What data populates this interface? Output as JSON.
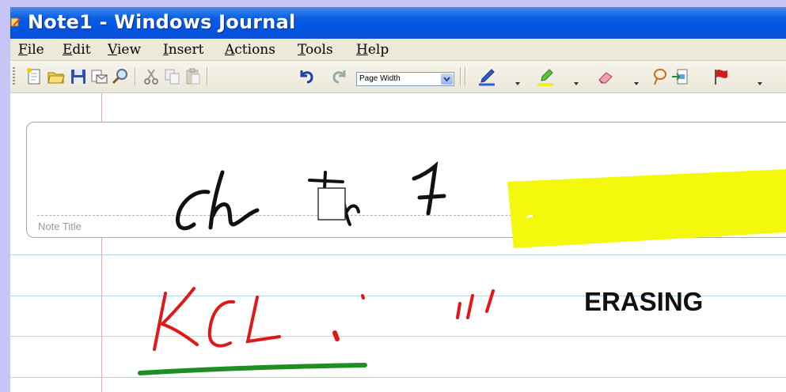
{
  "window": {
    "title": "Note1 - Windows Journal"
  },
  "menu": [
    {
      "label": "File"
    },
    {
      "label": "Edit"
    },
    {
      "label": "View"
    },
    {
      "label": "Insert"
    },
    {
      "label": "Actions"
    },
    {
      "label": "Tools"
    },
    {
      "label": "Help"
    }
  ],
  "toolbar": {
    "zoom_value": "Page Width",
    "icons": [
      "new-note-icon",
      "open-folder-icon",
      "save-disk-icon",
      "send-email-icon",
      "find-magnifier-icon",
      "cut-scissors-icon",
      "copy-icon",
      "paste-icon",
      "undo-icon",
      "redo-icon",
      "pen-icon",
      "highlighter-icon",
      "eraser-icon",
      "lasso-select-icon",
      "insert-space-icon",
      "flag-icon"
    ]
  },
  "page": {
    "note_title_label": "Note Title",
    "text_box": "ERASING"
  },
  "colors": {
    "titlebar": "#0055e5",
    "desktop": "#c7c5f5",
    "highlight": "#f2f800",
    "ink_red": "#e01818",
    "ink_green": "#1e8f22",
    "rule_line": "#b9d3e8",
    "margin_line": "#e4aaaa"
  }
}
